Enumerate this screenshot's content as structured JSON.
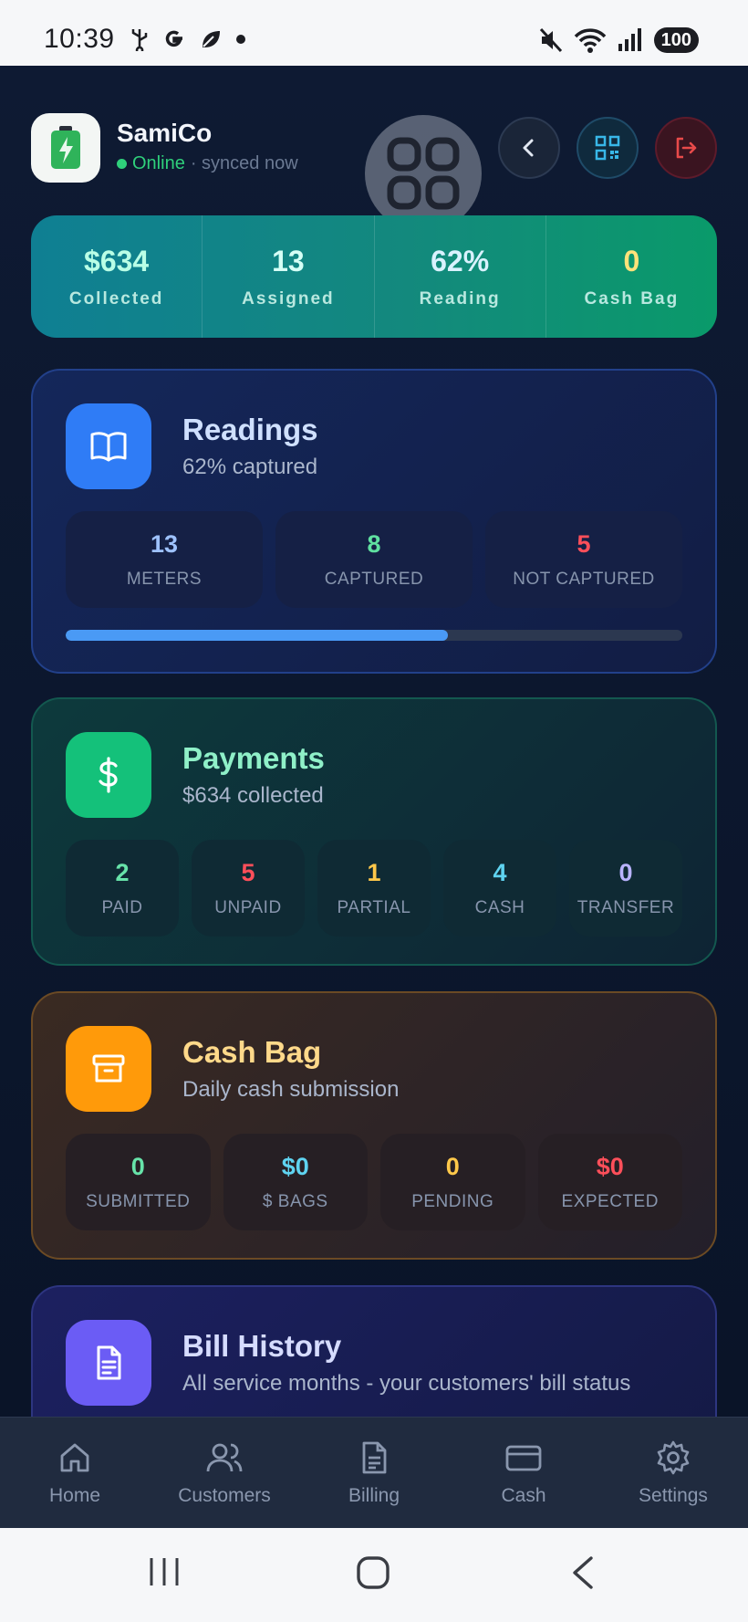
{
  "status_bar": {
    "time": "10:39",
    "battery": "100"
  },
  "header": {
    "app_name": "SamiCo",
    "status_online": "Online",
    "status_synced": "· synced now"
  },
  "summary": [
    {
      "value": "$634",
      "label": "Collected",
      "color": "#b9ffe6"
    },
    {
      "value": "13",
      "label": "Assigned",
      "color": "#d5fff6"
    },
    {
      "value": "62%",
      "label": "Reading",
      "color": "#d9f2ff"
    },
    {
      "value": "0",
      "label": "Cash Bag",
      "color": "#ffe27a"
    }
  ],
  "readings": {
    "title": "Readings",
    "subtitle": "62% captured",
    "progress": 0.62,
    "stats": [
      {
        "value": "13",
        "label": "METERS",
        "color": "#9ec2ff"
      },
      {
        "value": "8",
        "label": "CAPTURED",
        "color": "#5fe0a0"
      },
      {
        "value": "5",
        "label": "NOT CAPTURED",
        "color": "#ff4f5a"
      }
    ]
  },
  "payments": {
    "title": "Payments",
    "subtitle": "$634 collected",
    "stats": [
      {
        "value": "2",
        "label": "PAID",
        "color": "#67e3a9"
      },
      {
        "value": "5",
        "label": "UNPAID",
        "color": "#ff4f5a"
      },
      {
        "value": "1",
        "label": "PARTIAL",
        "color": "#ffc84a"
      },
      {
        "value": "4",
        "label": "CASH",
        "color": "#5fd3f0"
      },
      {
        "value": "0",
        "label": "TRANSFER",
        "color": "#b9b3ff"
      }
    ]
  },
  "cashbag": {
    "title": "Cash Bag",
    "subtitle": "Daily cash submission",
    "stats": [
      {
        "value": "0",
        "label": "SUBMITTED",
        "color": "#67e3a9"
      },
      {
        "value": "$0",
        "label": "$ BAGS",
        "color": "#5fd3f0"
      },
      {
        "value": "0",
        "label": "PENDING",
        "color": "#ffc84a"
      },
      {
        "value": "$0",
        "label": "EXPECTED",
        "color": "#ff4f5a"
      }
    ]
  },
  "bills": {
    "title": "Bill History",
    "subtitle": "All service months - your customers' bill status"
  },
  "bottom_nav": [
    {
      "label": "Home",
      "icon": "home-icon"
    },
    {
      "label": "Customers",
      "icon": "users-icon"
    },
    {
      "label": "Billing",
      "icon": "document-icon"
    },
    {
      "label": "Cash",
      "icon": "card-icon"
    },
    {
      "label": "Settings",
      "icon": "gear-icon"
    }
  ]
}
